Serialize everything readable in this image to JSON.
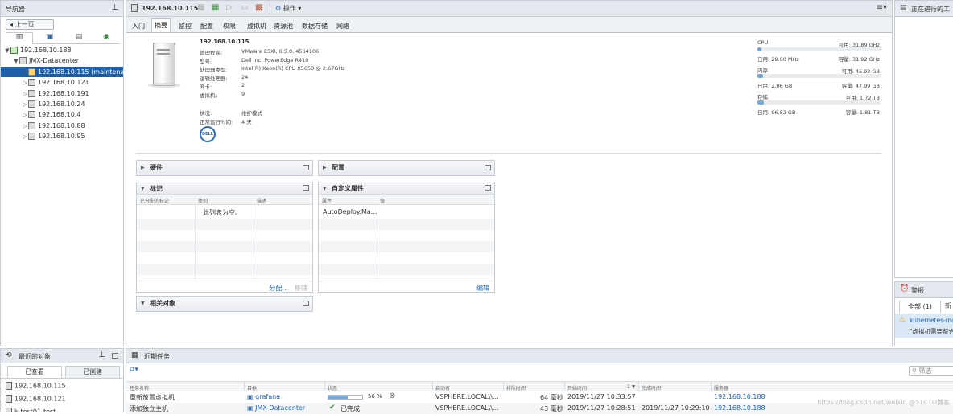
{
  "navigator": {
    "title": "导航器",
    "back": "上一页",
    "tree": [
      {
        "label": "192.168.10.188",
        "level": 0,
        "selected": false
      },
      {
        "label": "JMX-Datacenter",
        "level": 1,
        "selected": false
      },
      {
        "label": "192.168.10.115 (maintena...",
        "level": 2,
        "selected": true
      },
      {
        "label": "192.168.10.121",
        "level": 2,
        "selected": false
      },
      {
        "label": "192.168.10.191",
        "level": 2,
        "selected": false
      },
      {
        "label": "192.168.10.24",
        "level": 2,
        "selected": false
      },
      {
        "label": "192.168.10.4",
        "level": 2,
        "selected": false
      },
      {
        "label": "192.168.10.88",
        "level": 2,
        "selected": false
      },
      {
        "label": "192.168.10.95",
        "level": 2,
        "selected": false
      }
    ]
  },
  "main": {
    "host_title": "192.168.10.115",
    "actions": "操作",
    "tabs": [
      "入门",
      "摘要",
      "监控",
      "配置",
      "权限",
      "虚拟机",
      "资源池",
      "数据存储",
      "网络"
    ],
    "active_tab": 1
  },
  "summary": {
    "name": "192.168.10.115",
    "fields": [
      {
        "label": "管理程序:",
        "value": "VMware ESXi, 6.5.0, 4564106"
      },
      {
        "label": "型号:",
        "value": "Dell Inc. PowerEdge R410"
      },
      {
        "label": "处理器类型:",
        "value": "Intel(R) Xeon(R) CPU X5650 @ 2.67GHz"
      },
      {
        "label": "逻辑处理器:",
        "value": "24"
      },
      {
        "label": "网卡:",
        "value": "2"
      },
      {
        "label": "虚拟机:",
        "value": "9"
      }
    ],
    "state_label": "状况:",
    "state_value": "维护模式",
    "uptime_label": "正常运行时间:",
    "uptime_value": "4 天",
    "vendor_logo": "DELL"
  },
  "resources": [
    {
      "name": "CPU",
      "free": "可用: 31.89 GHz",
      "used": "已用: 29.00 MHz",
      "capacity": "容量: 31.92 GHz",
      "fraction": 0.01
    },
    {
      "name": "内存",
      "free": "可用: 45.92 GB",
      "used": "已用: 2.06 GB",
      "capacity": "容量: 47.99 GB",
      "fraction": 0.043
    },
    {
      "name": "存储",
      "free": "可用: 1.72 TB",
      "used": "已用: 96.82 GB",
      "capacity": "容量: 1.81 TB",
      "fraction": 0.052
    }
  ],
  "portlets": {
    "hardware": "硬件",
    "config": "配置",
    "tags": {
      "title": "标记",
      "columns": [
        "已分配的标记",
        "类别",
        "描述"
      ],
      "empty": "此列表为空。",
      "assign": "分配...",
      "remove": "移除"
    },
    "custom": {
      "title": "自定义属性",
      "columns": [
        "属性",
        "值"
      ],
      "row": "AutoDeploy.Ma...",
      "edit": "编辑"
    },
    "related": "相关对象"
  },
  "right": {
    "in_progress": "正在进行的工",
    "alarms": "警报",
    "alarm_tabs": [
      "全部 (1)",
      "新"
    ],
    "alarm_item": "kubernetes-ma",
    "alarm_desc": "\"虚拟机需要整合"
  },
  "recent_objects": {
    "title": "最近的对象",
    "tabs": [
      "已查看",
      "已创建"
    ],
    "items": [
      "192.168.10.115",
      "192.168.10.121",
      "k-test01-test"
    ]
  },
  "recent_tasks": {
    "title": "近期任务",
    "filter_placeholder": "筛选",
    "columns": [
      "任务名称",
      "目标",
      "状态",
      "启动者",
      "排队时间",
      "开始时间",
      "完成时间",
      "服务器"
    ],
    "sort_marker": "1 ▼",
    "rows": [
      {
        "name": "重新放置虚拟机",
        "target": "grafana",
        "status": "56 %",
        "progress": 0.56,
        "initiator": "VSPHERE.LOCAL\\\\...",
        "queued": "64 毫秒",
        "start": "2019/11/27 10:33:57",
        "end": "",
        "server": "192.168.10.188"
      },
      {
        "name": "添加独立主机",
        "target": "JMX-Datacenter",
        "status": "已完成",
        "progress": 1,
        "initiator": "VSPHERE.LOCAL\\\\...",
        "queued": "43 毫秒",
        "start": "2019/11/27 10:28:51",
        "end": "2019/11/27 10:29:10",
        "server": "192.168.10.188"
      }
    ]
  },
  "watermark": "https://blog.csdn.net/weixin @51CTO博客"
}
